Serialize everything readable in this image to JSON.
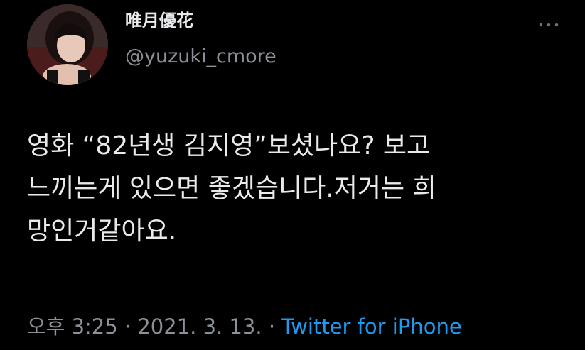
{
  "author": {
    "display_name": "唯月優花",
    "handle": "@yuzuki_cmore"
  },
  "tweet": {
    "text": "영화 “82년생 김지영”보셨나요? 보고\n느끼는게 있으면 좋겠습니다.저거는 희\n망인거같아요."
  },
  "meta": {
    "time": "오후 3:25",
    "separator": " · ",
    "date": "2021. 3. 13.",
    "separator2": " · ",
    "source": "Twitter for iPhone"
  },
  "icons": {
    "more": "more-horizontal-icon",
    "avatar": "profile-avatar"
  },
  "colors": {
    "background": "#000000",
    "text": "#e7e9ea",
    "secondary": "#8b9198",
    "link": "#1d9bf0"
  }
}
